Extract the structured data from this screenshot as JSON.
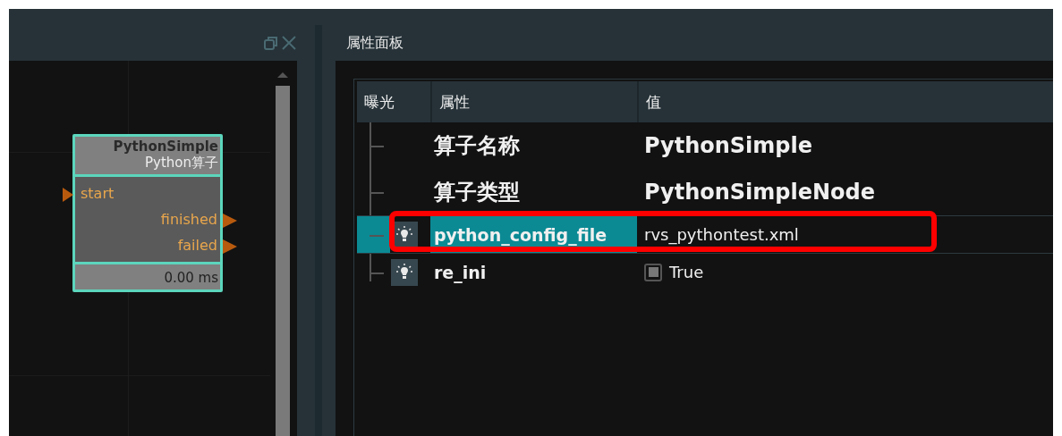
{
  "node": {
    "title": "PythonSimple",
    "subtitle": "Python算子",
    "inputs": [
      "start"
    ],
    "outputs": [
      "finished",
      "failed"
    ],
    "timing": "0.00 ms",
    "selected": true
  },
  "properties_panel": {
    "title": "属性面板",
    "columns": [
      "曝光",
      "属性",
      "值"
    ],
    "rows": [
      {
        "kind": "heading",
        "name": "算子名称",
        "value": "PythonSimple",
        "selected": false
      },
      {
        "kind": "heading",
        "name": "算子类型",
        "value": "PythonSimpleNode",
        "selected": false
      },
      {
        "kind": "param",
        "name": "python_config_file",
        "value": "rvs_pythontest.xml",
        "selected": true,
        "highlighted": true
      },
      {
        "kind": "bool",
        "name": "re_ini",
        "value": "True",
        "checked": true,
        "selected": false
      }
    ]
  }
}
